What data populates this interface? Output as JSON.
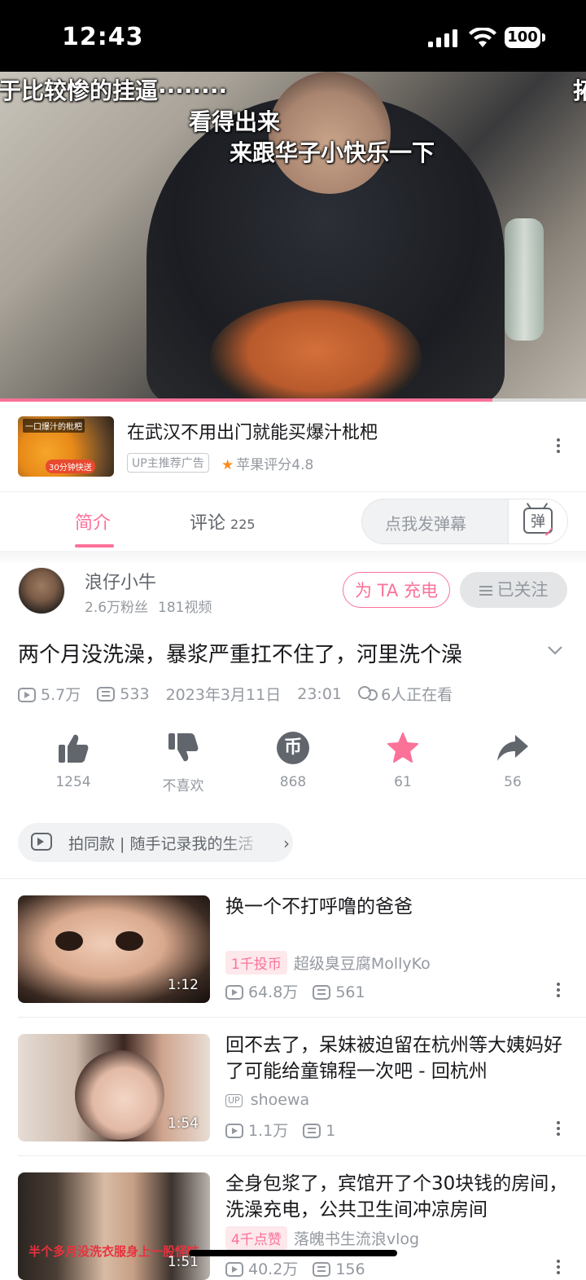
{
  "status_bar": {
    "time": "12:43",
    "battery": "100"
  },
  "video": {
    "captions": [
      "于比较惨的挂逼········",
      "看得出来",
      "来跟华子小快乐一下",
      "拓"
    ],
    "progress_fraction": 0.84
  },
  "ad": {
    "thumb_text_top": "一口爆汁的枇杷",
    "thumb_text_bottom": "30分钟快送",
    "title": "在武汉不用出门就能买爆汁枇杷",
    "tag": "UP主推荐广告",
    "rating": "苹果评分4.8"
  },
  "tabs": {
    "intro": "简介",
    "comments": "评论",
    "comments_count": "225",
    "danmu_placeholder": "点我发弹幕",
    "danmu_icon_char": "弹"
  },
  "uploader": {
    "name": "浪仔小牛",
    "fans": "2.6万粉丝",
    "videos": "181视频",
    "charge_label": "为 TA 充电",
    "follow_label": "已关注"
  },
  "video_info": {
    "title": "两个月没洗澡，暴浆严重扛不住了，河里洗个澡",
    "views": "5.7万",
    "danmaku": "533",
    "date": "2023年3月11日",
    "time": "23:01",
    "watching": "6人正在看"
  },
  "actions": [
    {
      "icon": "thumbs-up-icon",
      "label": "1254"
    },
    {
      "icon": "thumbs-down-icon",
      "label": "不喜欢"
    },
    {
      "icon": "coin-icon",
      "label": "868"
    },
    {
      "icon": "star-icon",
      "label": "61"
    },
    {
      "icon": "share-icon",
      "label": "56"
    }
  ],
  "shoot_same": {
    "label": "拍同款 | 随手记录我的生活"
  },
  "recommendations": [
    {
      "title": "换一个不打呼噜的爸爸",
      "duration": "1:12",
      "badge": "1千投币",
      "author": "超级臭豆腐MollyKo",
      "views": "64.8万",
      "danmaku": "561"
    },
    {
      "title": "回不去了，呆妹被迫留在杭州等大姨妈好了可能给童锦程一次吧 - 回杭州",
      "duration": "1:54",
      "up_badge": "UP",
      "author": "shoewa",
      "views": "1.1万",
      "danmaku": "1"
    },
    {
      "title": "全身包浆了，宾馆开了个30块钱的房间，洗澡充电，公共卫生间冲凉房间",
      "duration": "1:51",
      "thumb_caption": "半个多月没洗衣服身上一股怪味",
      "badge": "4千点赞",
      "author": "落魄书生流浪vlog",
      "views": "40.2万",
      "danmaku": "156"
    }
  ],
  "colors": {
    "accent": "#fb7299",
    "text_secondary": "#9499a0",
    "text_primary": "#18191c"
  }
}
